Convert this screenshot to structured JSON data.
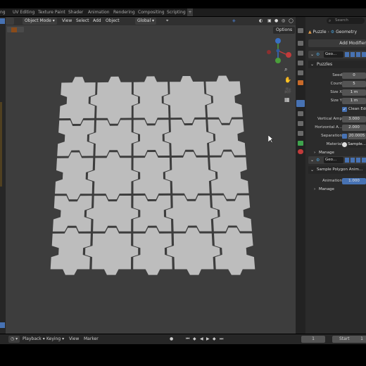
{
  "workspace_tabs": [
    "ng",
    "UV Editing",
    "Texture Paint",
    "Shader",
    "Animation",
    "Rendering",
    "Compositing",
    "Scripting"
  ],
  "header": {
    "mode": "Object Mode",
    "menus": [
      "View",
      "Select",
      "Add",
      "Object"
    ],
    "transform_orientation": "Global",
    "options_label": "Options"
  },
  "props": {
    "search_placeholder": "Search",
    "breadcrumb": [
      "Puzzle",
      "Geometry"
    ],
    "add_modifier": "Add Modifier",
    "modifier1": {
      "name": "Geo...",
      "group": "Puzzles",
      "fields": [
        {
          "label": "Seed",
          "value": "0"
        },
        {
          "label": "Count",
          "value": "5"
        },
        {
          "label": "Size X",
          "value": "1 m"
        },
        {
          "label": "Size Y",
          "value": "1 m"
        }
      ],
      "checkbox_label": "Clean Edg",
      "fields2": [
        {
          "label": "Vertical Amp",
          "value": "3.000"
        },
        {
          "label": "Horizontal A...",
          "value": "2.000"
        },
        {
          "label": "Separation",
          "value": "20.0005"
        }
      ],
      "material_label": "Material",
      "material_value": "Sample...",
      "manage": "Manage"
    },
    "modifier2": {
      "name": "Geo...",
      "group": "Sample Polygon Anim...",
      "field_label": "Animation",
      "field_value": "1.000",
      "manage": "Manage"
    }
  },
  "timeline": {
    "menus": [
      "Playback",
      "Keying",
      "View",
      "Marker"
    ],
    "current_frame": "1",
    "start_label": "Start",
    "start_value": "1"
  },
  "puzzle_grid": {
    "rows": 5,
    "cols": 5
  }
}
